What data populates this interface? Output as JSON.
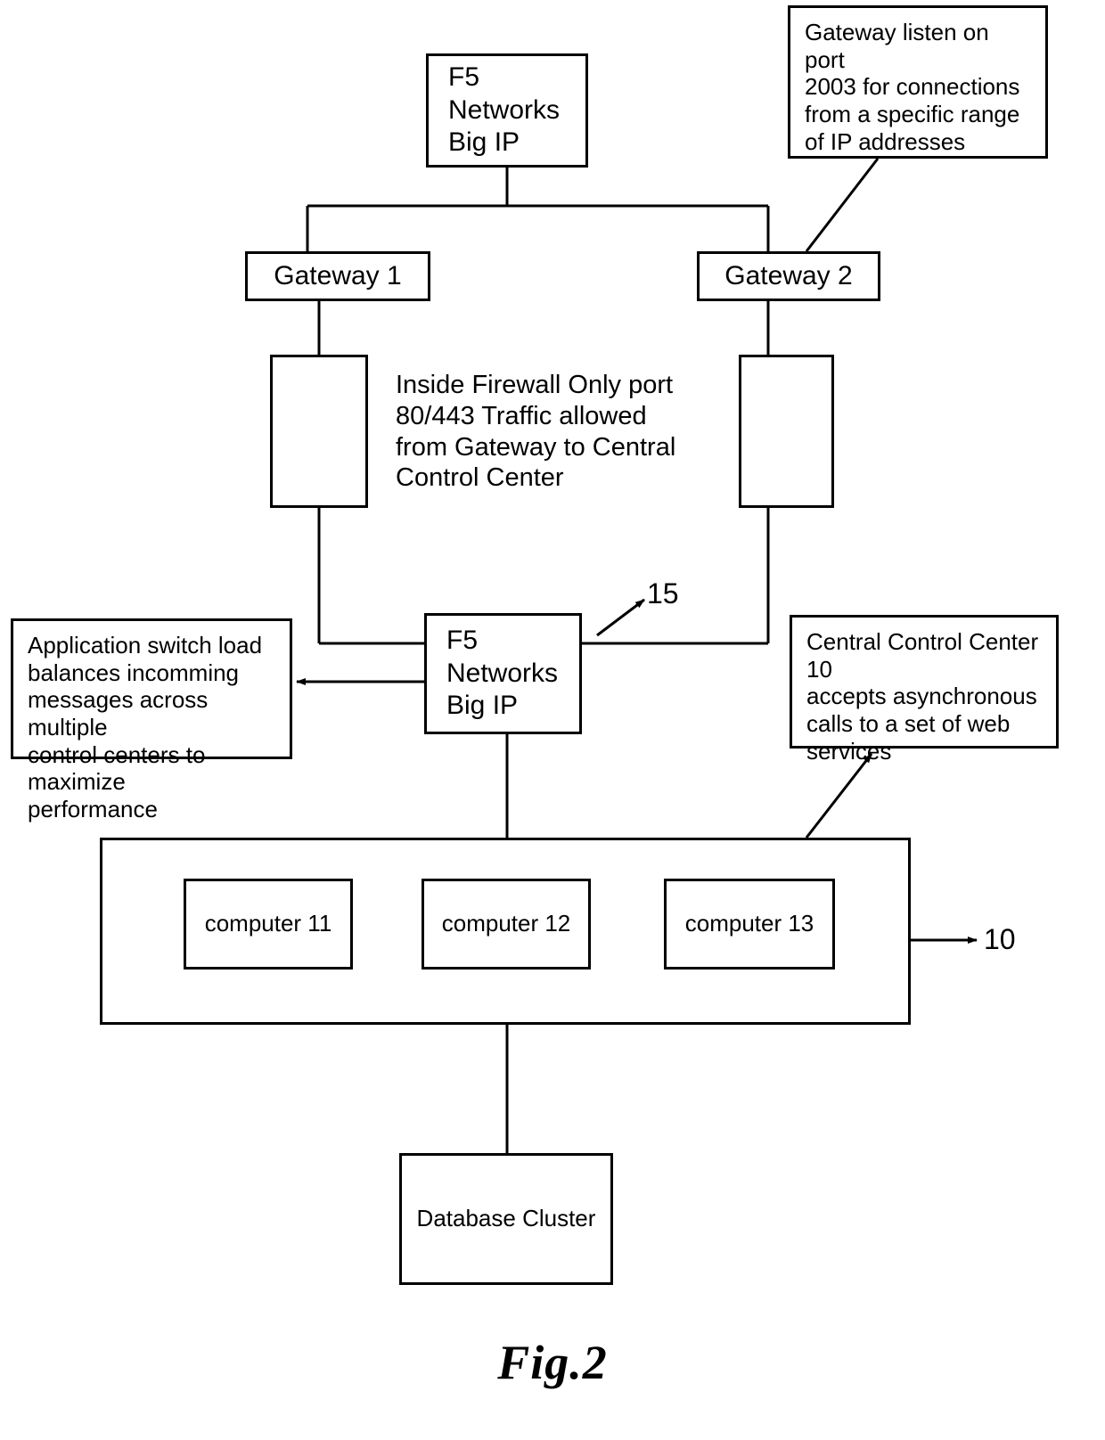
{
  "figure": {
    "caption": "Fig.2"
  },
  "nodes": {
    "f5_top": {
      "label": "F5\nNetworks\nBig IP"
    },
    "gateway1": {
      "label": "Gateway 1"
    },
    "gateway2": {
      "label": "Gateway 2"
    },
    "firewall_left": {
      "label": ""
    },
    "firewall_right": {
      "label": ""
    },
    "f5_mid": {
      "label": "F5\nNetworks\nBig IP"
    },
    "control_center": {
      "label": ""
    },
    "computer11": {
      "label": "computer 11"
    },
    "computer12": {
      "label": "computer 12"
    },
    "computer13": {
      "label": "computer 13"
    },
    "database": {
      "label": "Database Cluster"
    }
  },
  "notes": {
    "gateway_port": "Gateway listen on port\n2003 for connections\nfrom a specific range\nof IP addresses",
    "firewall": "Inside Firewall Only port\n80/443 Traffic allowed\nfrom Gateway to Central\nControl Center",
    "app_switch": "Application switch load\nbalances incomming\nmessages across multiple\ncontrol centers to maximize\nperformance",
    "central_control_center": "Central Control Center 10\naccepts asynchronous\ncalls to a set of web\nservices"
  },
  "reference_numerals": {
    "f5_mid": "15",
    "control_center": "10"
  },
  "colors": {
    "stroke": "#000000",
    "background": "#ffffff"
  }
}
